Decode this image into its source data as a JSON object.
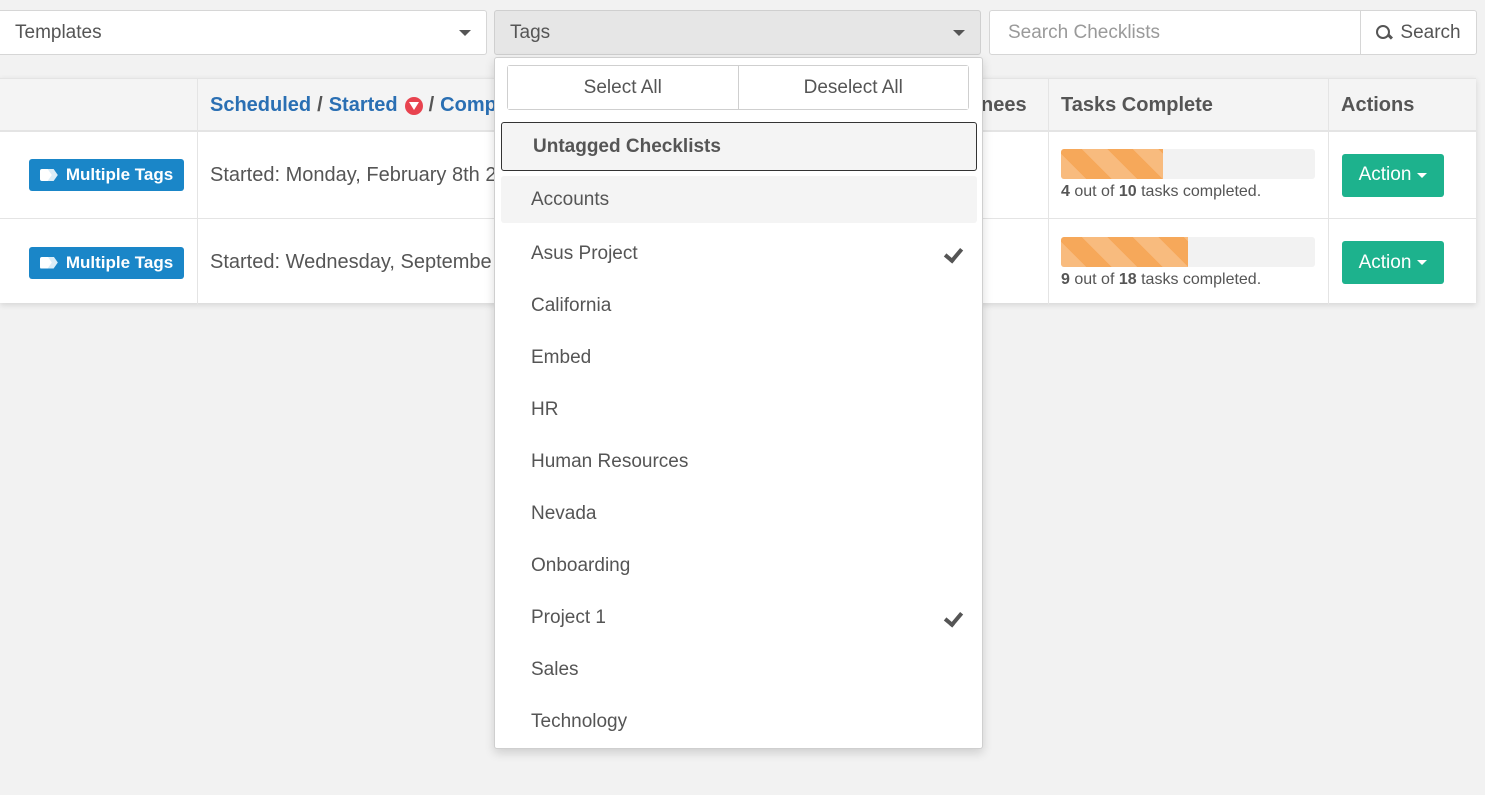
{
  "filters": {
    "templates_label": "Templates",
    "tags_label": "Tags",
    "search_placeholder": "Search Checklists",
    "search_button": "Search"
  },
  "table": {
    "headers": {
      "scheduled": "Scheduled",
      "sep1": "/",
      "started": "Started",
      "sep2": "/",
      "completed_partial": "Comp",
      "assignees_partial": "nees",
      "tasks_complete": "Tasks Complete",
      "actions": "Actions"
    },
    "rows": [
      {
        "tag_label": "Multiple Tags",
        "started": "Started: Monday, February 8th 2",
        "done": "4",
        "total": "10",
        "progress_fraction": 0.4,
        "action_label": "Action"
      },
      {
        "tag_label": "Multiple Tags",
        "started": "Started: Wednesday, Septembe",
        "done": "9",
        "total": "18",
        "progress_fraction": 0.5,
        "action_label": "Action"
      }
    ],
    "progress_words": {
      "out_of": "out of",
      "suffix": "tasks completed."
    }
  },
  "dropdown": {
    "select_all": "Select All",
    "deselect_all": "Deselect All",
    "untagged": "Untagged Checklists",
    "items": [
      {
        "label": "Accounts",
        "checked": false
      },
      {
        "label": "Asus Project",
        "checked": true
      },
      {
        "label": "California",
        "checked": false
      },
      {
        "label": "Embed",
        "checked": false
      },
      {
        "label": "HR",
        "checked": false
      },
      {
        "label": "Human Resources",
        "checked": false
      },
      {
        "label": "Nevada",
        "checked": false
      },
      {
        "label": "Onboarding",
        "checked": false
      },
      {
        "label": "Project 1",
        "checked": true
      },
      {
        "label": "Sales",
        "checked": false
      },
      {
        "label": "Technology",
        "checked": false
      }
    ]
  },
  "colors": {
    "link_blue": "#2a6fb3",
    "tag_blue": "#1a86c8",
    "action_green": "#1db28d",
    "progress_orange": "#f6a85a",
    "sort_red": "#e8434f"
  }
}
